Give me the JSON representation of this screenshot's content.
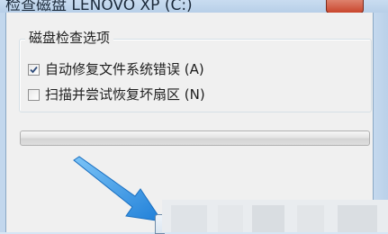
{
  "window": {
    "title": "检查磁盘 LENOVO XP (C:)"
  },
  "dialog": {
    "group_label": "磁盘检查选项",
    "options": [
      {
        "label": "自动修复文件系统错误 (A)",
        "checked": true
      },
      {
        "label": "扫描并尝试恢复坏扇区 (N)",
        "checked": false
      }
    ],
    "progress": 0
  },
  "colors": {
    "arrow": "#2a8ee6",
    "titlebar": "#bcd3ea",
    "client_bg": "#f0f0f0"
  },
  "icons": {
    "arrow": "pointer-arrow-icon",
    "check": "checkmark-icon"
  }
}
